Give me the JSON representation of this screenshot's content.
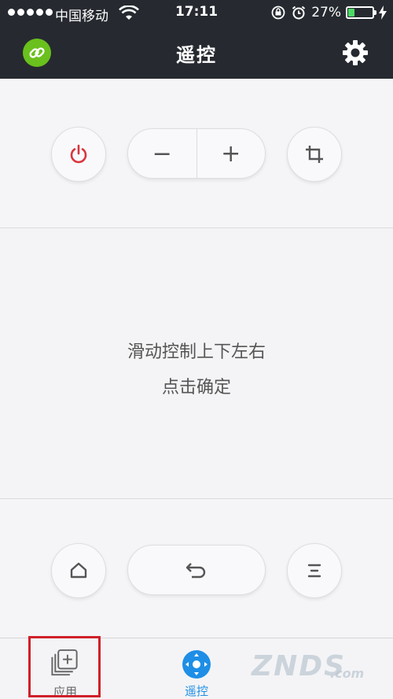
{
  "status_bar": {
    "carrier": "中国移动",
    "time": "17:11",
    "battery": "27%",
    "battery_level": 0.27
  },
  "header": {
    "title": "遥控"
  },
  "touch_area": {
    "hint_line1": "滑动控制上下左右",
    "hint_line2": "点击确定"
  },
  "controls_top": {
    "volume_down_label": "−",
    "volume_up_label": "+"
  },
  "tabbar": {
    "tabs": [
      {
        "label": "应用"
      },
      {
        "label": "遥控"
      }
    ]
  },
  "watermark": {
    "brand": "ZNDS",
    "suffix": ".com"
  },
  "colors": {
    "header_bg": "#262a30",
    "link_green": "#6ac01d",
    "power_red": "#d9363e",
    "active_blue": "#1e8ee6",
    "highlight_red": "#d0202a"
  }
}
